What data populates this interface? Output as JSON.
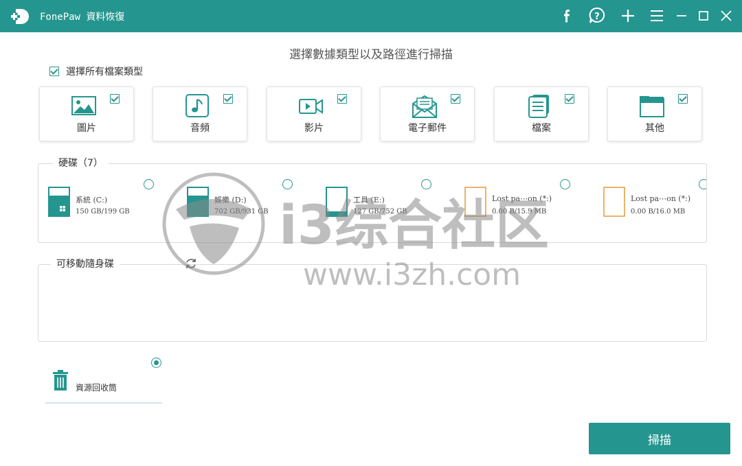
{
  "app": {
    "name": "FonePaw 資料恢復"
  },
  "titlebar": {
    "buttons": [
      {
        "name": "facebook-icon",
        "glyph": "f"
      },
      {
        "name": "help-chat-icon"
      },
      {
        "name": "plus-icon"
      },
      {
        "name": "menu-icon"
      },
      {
        "name": "minimize-icon"
      },
      {
        "name": "maximize-icon"
      },
      {
        "name": "close-icon"
      }
    ]
  },
  "main": {
    "title": "選擇數據類型以及路徑進行掃描",
    "select_all_label": "選擇所有檔案類型",
    "select_all_checked": true
  },
  "file_types": [
    {
      "label": "圖片",
      "icon": "image-icon",
      "checked": true
    },
    {
      "label": "音頻",
      "icon": "music-note-icon",
      "checked": true
    },
    {
      "label": "影片",
      "icon": "video-camera-icon",
      "checked": true
    },
    {
      "label": "電子郵件",
      "icon": "envelope-icon",
      "checked": true
    },
    {
      "label": "檔案",
      "icon": "document-icon",
      "checked": true
    },
    {
      "label": "其他",
      "icon": "folder-icon",
      "checked": true
    }
  ],
  "hard_drives": {
    "label": "硬碟（7）",
    "drives": [
      {
        "name": "系統 (C:)",
        "size": "150 GB/199 GB",
        "fill": 0.75,
        "icon": "windows-drive-icon",
        "selected": false
      },
      {
        "name": "娛樂 (D:)",
        "size": "702 GB/931 GB",
        "fill": 0.75,
        "icon": "disk-drive-icon",
        "selected": false
      },
      {
        "name": "工具 (E:)",
        "size": "127 GB/752 GB",
        "fill": 0.17,
        "icon": "disk-drive-icon",
        "selected": false
      },
      {
        "name": "Lost pa⋯on (*:)",
        "size": "0.00  B/15.9 MB",
        "fill": 0,
        "icon": "lost-partition-icon",
        "selected": false
      },
      {
        "name": "Lost pa⋯on (*:)",
        "size": "0.00  B/16.0 MB",
        "fill": 0,
        "icon": "lost-partition-icon",
        "selected": false
      }
    ]
  },
  "removable": {
    "label": "可移動隨身碟"
  },
  "recycle_bin": {
    "label": "資源回收筒",
    "selected": true
  },
  "scan_button": {
    "label": "掃描"
  },
  "watermark": {
    "text": "i3综合社区",
    "url": "www.i3zh.com"
  },
  "colors": {
    "accent": "#25958f",
    "lost_partition": "#e39a3a"
  }
}
